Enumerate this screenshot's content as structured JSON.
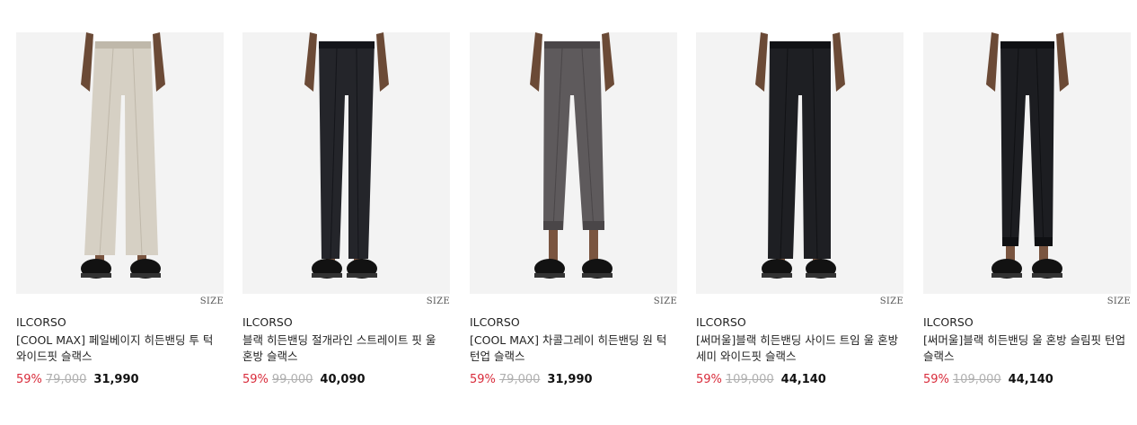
{
  "products": [
    {
      "brand": "ILCORSO",
      "title": "[COOL MAX] 페일베이지 히든밴딩 투 턱 와이드핏 슬랙스",
      "size_label": "SIZE",
      "discount": "59%",
      "original_price": "79,000",
      "sale_price": "31,990",
      "image": {
        "pants_color": "#d6d0c4",
        "pants_shadow": "#bfb8aa",
        "fit": "wide",
        "cuff": false
      }
    },
    {
      "brand": "ILCORSO",
      "title": "블랙 히든밴딩 절개라인 스트레이트 핏 울 혼방 슬랙스",
      "size_label": "SIZE",
      "discount": "59%",
      "original_price": "99,000",
      "sale_price": "40,090",
      "image": {
        "pants_color": "#24252a",
        "pants_shadow": "#14151a",
        "fit": "straight",
        "cuff": false
      }
    },
    {
      "brand": "ILCORSO",
      "title": "[COOL MAX] 차콜그레이 히든밴딩 원 턱 턴업 슬랙스",
      "size_label": "SIZE",
      "discount": "59%",
      "original_price": "79,000",
      "sale_price": "31,990",
      "image": {
        "pants_color": "#5e5a5c",
        "pants_shadow": "#4a4648",
        "fit": "cropped",
        "cuff": true
      }
    },
    {
      "brand": "ILCORSO",
      "title": "[써머울]블랙 히든밴딩 사이드 트임 울 혼방 세미 와이드핏 슬랙스",
      "size_label": "SIZE",
      "discount": "59%",
      "original_price": "109,000",
      "sale_price": "44,140",
      "image": {
        "pants_color": "#1e1f23",
        "pants_shadow": "#111215",
        "fit": "semiwide",
        "cuff": false
      }
    },
    {
      "brand": "ILCORSO",
      "title": "[써머울]블랙 히든밴딩 울 혼방 슬림핏 턴업 슬랙스",
      "size_label": "SIZE",
      "discount": "59%",
      "original_price": "109,000",
      "sale_price": "44,140",
      "image": {
        "pants_color": "#1c1d21",
        "pants_shadow": "#0f1013",
        "fit": "slim",
        "cuff": true
      }
    }
  ],
  "colors": {
    "discount": "#d92c3b",
    "original_price": "#b0b0b0",
    "image_background": "#f3f3f3"
  }
}
